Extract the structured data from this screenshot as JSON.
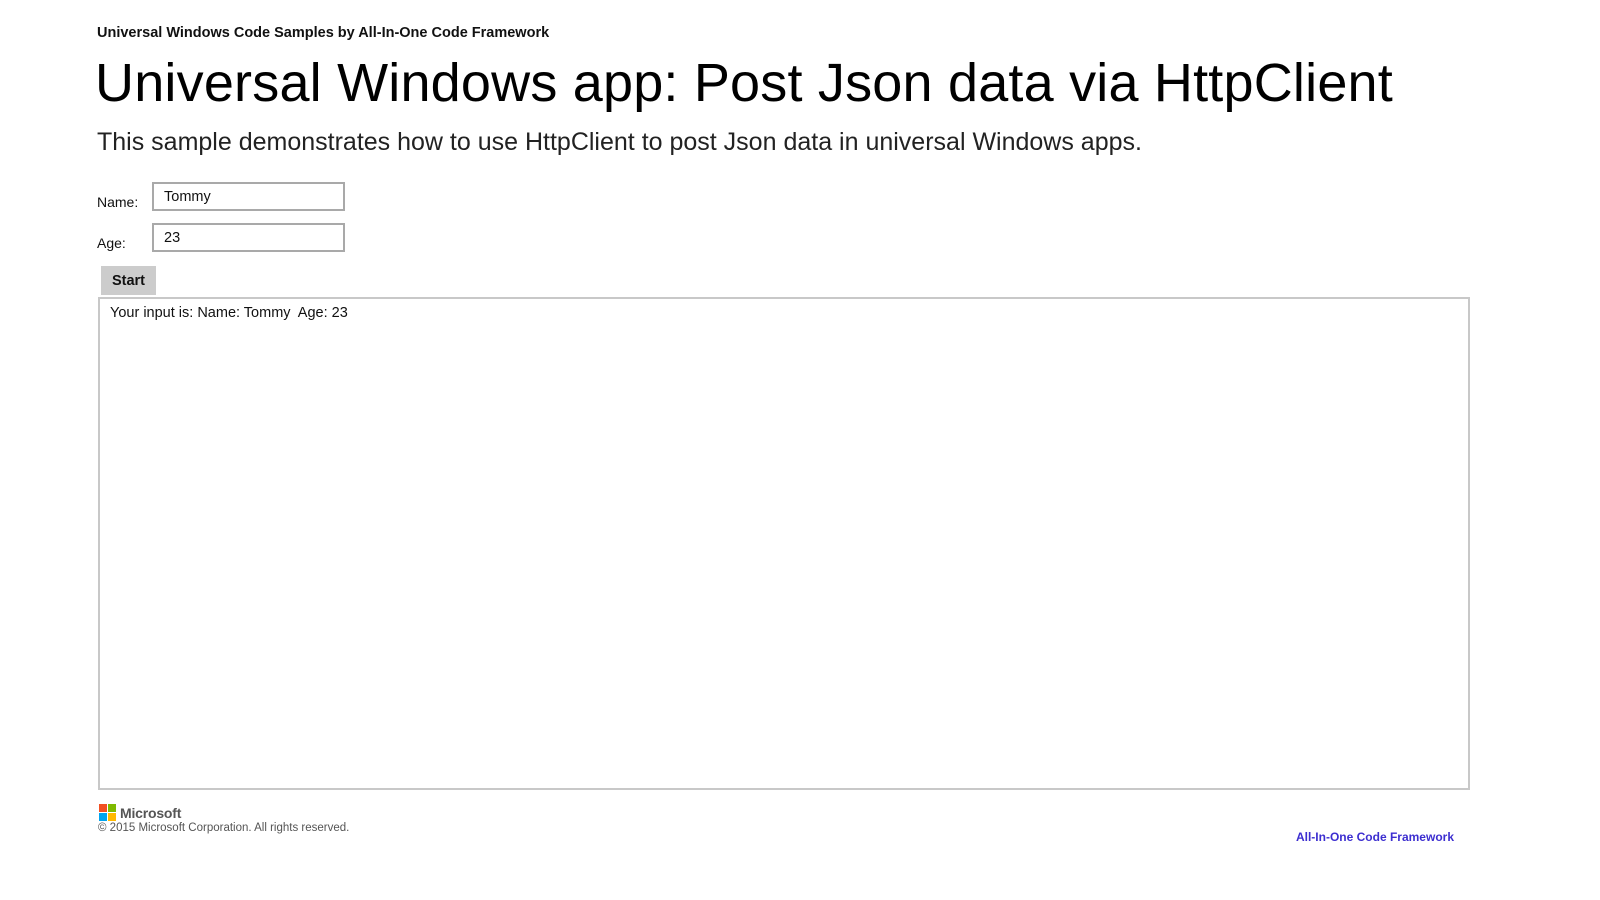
{
  "header": {
    "caption": "Universal Windows Code Samples by All-In-One Code Framework",
    "title": "Universal Windows app: Post Json data via HttpClient",
    "subtitle": "This sample demonstrates how to use HttpClient to post Json data in universal Windows apps."
  },
  "form": {
    "name_label": "Name:",
    "name_value": "Tommy",
    "age_label": "Age:",
    "age_value": "23",
    "start_label": "Start"
  },
  "output": {
    "text": "Your input is: Name: Tommy  Age: 23"
  },
  "footer": {
    "logo_text": "Microsoft",
    "logo_colors": [
      "#f25022",
      "#7fba00",
      "#00a4ef",
      "#ffb900"
    ],
    "copyright": "© 2015 Microsoft Corporation. All rights reserved.",
    "link_text": "All-In-One Code Framework",
    "link_color": "#3c2ed0"
  }
}
